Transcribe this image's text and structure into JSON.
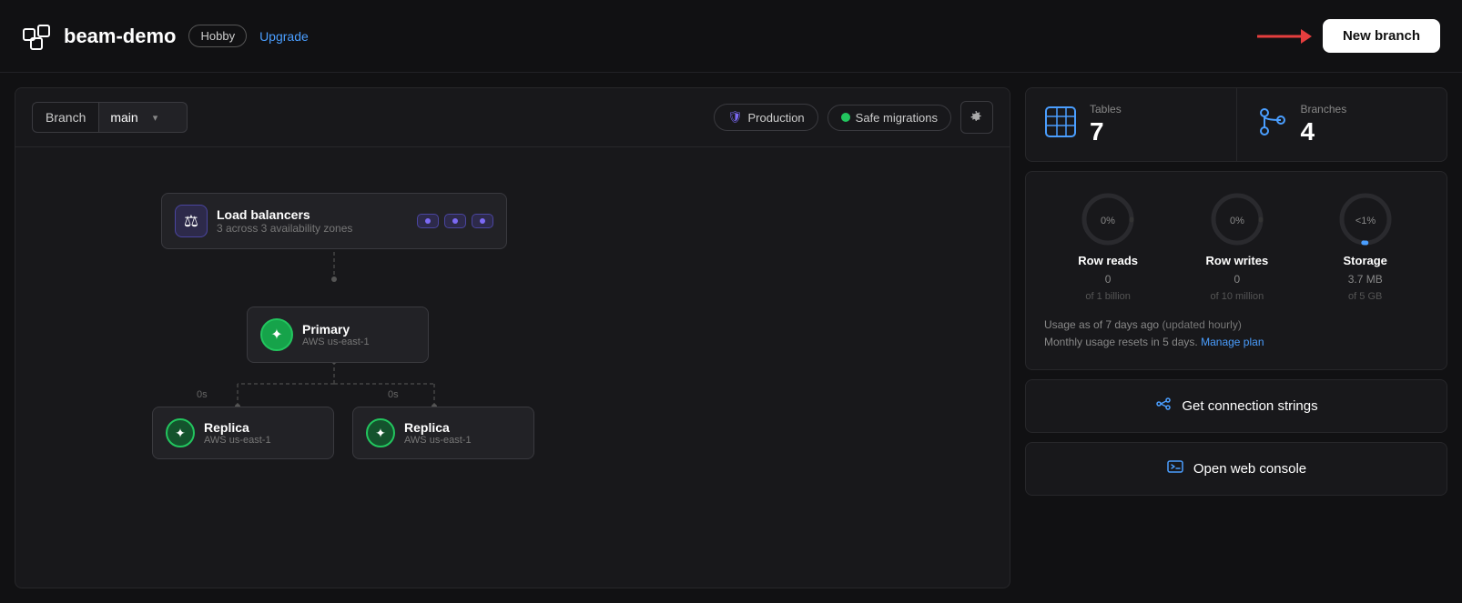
{
  "header": {
    "app_name": "beam-demo",
    "plan_label": "Hobby",
    "upgrade_label": "Upgrade",
    "new_branch_label": "New branch"
  },
  "toolbar": {
    "branch_label": "Branch",
    "branch_selected": "main",
    "production_label": "Production",
    "safe_migrations_label": "Safe migrations"
  },
  "diagram": {
    "lb_title": "Load balancers",
    "lb_subtitle": "3 across 3 availability zones",
    "lb_badges": [
      "",
      "",
      ""
    ],
    "primary_title": "Primary",
    "primary_subtitle": "AWS us-east-1",
    "replica_left_title": "Replica",
    "replica_left_subtitle": "AWS us-east-1",
    "replica_right_title": "Replica",
    "replica_right_subtitle": "AWS us-east-1",
    "timing_left": "0s",
    "timing_right": "0s"
  },
  "stats": {
    "tables_label": "Tables",
    "tables_value": "7",
    "branches_label": "Branches",
    "branches_value": "4"
  },
  "gauges": {
    "row_reads_label": "Row reads",
    "row_reads_value": "0",
    "row_reads_limit": "of 1 billion",
    "row_reads_pct": "0%",
    "row_writes_label": "Row writes",
    "row_writes_value": "0",
    "row_writes_limit": "of 10 million",
    "row_writes_pct": "0%",
    "storage_label": "Storage",
    "storage_value": "3.7 MB",
    "storage_limit": "of 5 GB",
    "storage_pct": "<1%"
  },
  "usage": {
    "text": "Usage as of 7 days ago",
    "updated": "(updated hourly)",
    "resets": "Monthly usage resets in 5 days.",
    "manage_label": "Manage plan"
  },
  "actions": {
    "connection_strings_label": "Get connection strings",
    "web_console_label": "Open web console"
  }
}
